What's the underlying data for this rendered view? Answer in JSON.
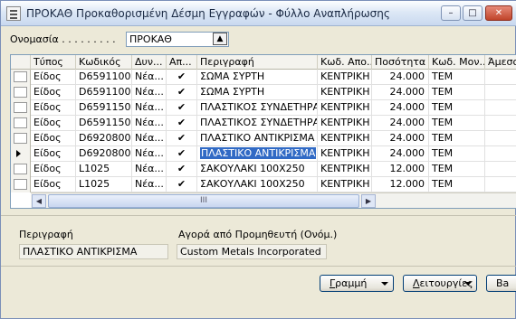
{
  "window": {
    "title": "ΠΡΟΚΑΘ Προκαθορισμένη Δέσμη Εγγραφών - Φύλλο Αναπλήρωσης",
    "controls": {
      "minimize": "–",
      "maximize": "□",
      "close": "✕"
    }
  },
  "name_field": {
    "label": "Ονομασία . . . . . . . . .",
    "value": "ΠΡΟΚΑΘ",
    "lookup_icon": "up-arrow-icon"
  },
  "grid": {
    "columns": [
      "Τύπος",
      "Κωδικός",
      "Δυν...",
      "Απ...",
      "Περιγραφή",
      "Κωδ. Απο...",
      "Ποσότητα",
      "Κωδ. Μον...",
      "Άμεσο"
    ],
    "rows": [
      {
        "type": "Είδος",
        "code": "D6591100",
        "dyn": "Νέα...",
        "ap": "✔",
        "desc": "ΣΩΜΑ ΣΥΡΤΗ",
        "loc": "ΚΕΝΤΡΙΚΗ",
        "qty": "24.000",
        "uom": "TEM",
        "current": false
      },
      {
        "type": "Είδος",
        "code": "D6591100",
        "dyn": "Νέα...",
        "ap": "✔",
        "desc": "ΣΩΜΑ ΣΥΡΤΗ",
        "loc": "ΚΕΝΤΡΙΚΗ",
        "qty": "24.000",
        "uom": "TEM",
        "current": false
      },
      {
        "type": "Είδος",
        "code": "D6591150",
        "dyn": "Νέα...",
        "ap": "✔",
        "desc": "ΠΛΑΣΤΙΚΟΣ ΣΥΝΔΕΤΗΡΑΣ",
        "loc": "ΚΕΝΤΡΙΚΗ",
        "qty": "24.000",
        "uom": "TEM",
        "current": false
      },
      {
        "type": "Είδος",
        "code": "D6591150",
        "dyn": "Νέα...",
        "ap": "✔",
        "desc": "ΠΛΑΣΤΙΚΟΣ ΣΥΝΔΕΤΗΡΑΣ",
        "loc": "ΚΕΝΤΡΙΚΗ",
        "qty": "24.000",
        "uom": "TEM",
        "current": false
      },
      {
        "type": "Είδος",
        "code": "D6920800",
        "dyn": "Νέα...",
        "ap": "✔",
        "desc": "ΠΛΑΣΤΙΚΟ ΑΝΤΙΚΡΙΣΜΑ",
        "loc": "ΚΕΝΤΡΙΚΗ",
        "qty": "24.000",
        "uom": "TEM",
        "current": false
      },
      {
        "type": "Είδος",
        "code": "D6920800",
        "dyn": "Νέα...",
        "ap": "✔",
        "desc": "ΠΛΑΣΤΙΚΟ ΑΝΤΙΚΡΙΣΜΑ",
        "loc": "ΚΕΝΤΡΙΚΗ",
        "qty": "24.000",
        "uom": "TEM",
        "current": true
      },
      {
        "type": "Είδος",
        "code": "L1025",
        "dyn": "Νέα...",
        "ap": "✔",
        "desc": "ΣΑΚΟΥΛΑΚΙ 100Χ250",
        "loc": "ΚΕΝΤΡΙΚΗ",
        "qty": "12.000",
        "uom": "TEM",
        "current": false
      },
      {
        "type": "Είδος",
        "code": "L1025",
        "dyn": "Νέα...",
        "ap": "✔",
        "desc": "ΣΑΚΟΥΛΑΚΙ 100Χ250",
        "loc": "ΚΕΝΤΡΙΚΗ",
        "qty": "12.000",
        "uom": "TEM",
        "current": false
      }
    ],
    "scroll_thumb_grip": "III"
  },
  "details": {
    "description_label": "Περιγραφή",
    "description_value": "ΠΛΑΣΤΙΚΟ ΑΝΤΙΚΡΙΣΜΑ",
    "vendor_label": "Αγορά από Προμηθευτή (Ονόμ.)",
    "vendor_value": "Custom Metals Incorporated"
  },
  "buttons": {
    "line_prefix": "",
    "line_underline": "Γ",
    "line_rest": "ραμμή",
    "functions_prefix": "",
    "functions_underline": "Λ",
    "functions_rest": "ειτουργίες",
    "third_label": "Ва"
  },
  "colors": {
    "selection": "#316ac5",
    "accent_border": "#003c74"
  }
}
